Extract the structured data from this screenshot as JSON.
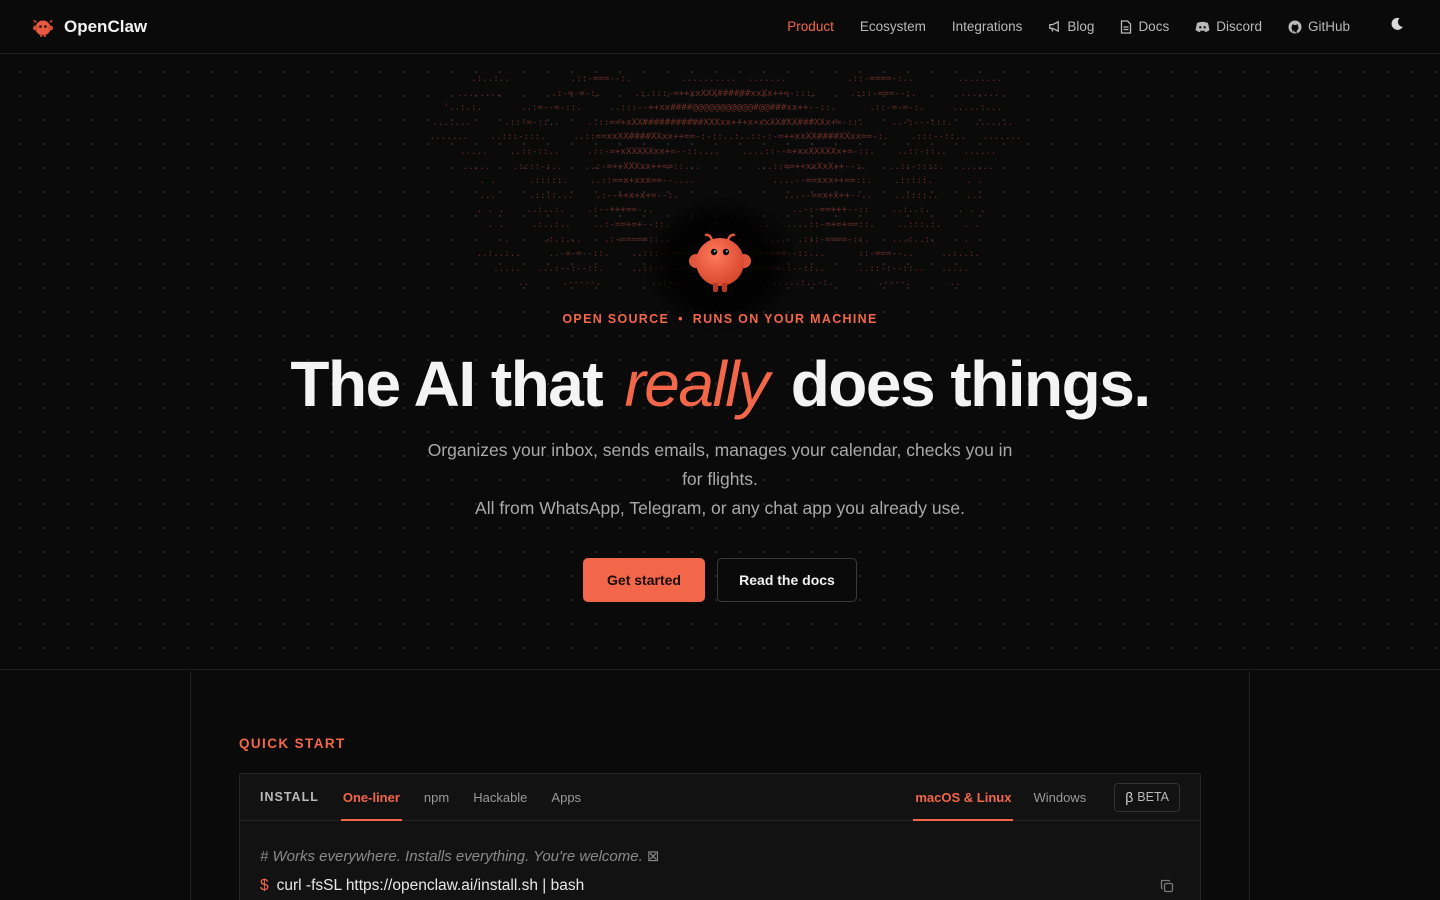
{
  "nav": {
    "brand": "OpenClaw",
    "links": [
      {
        "label": "Product",
        "active": true
      },
      {
        "label": "Ecosystem"
      },
      {
        "label": "Integrations"
      },
      {
        "label": "Blog",
        "icon": "megaphone-icon"
      },
      {
        "label": "Docs",
        "icon": "document-icon"
      },
      {
        "label": "Discord",
        "icon": "discord-icon"
      },
      {
        "label": "GitHub",
        "icon": "github-icon"
      }
    ],
    "theme_toggle_icon": "moon-icon"
  },
  "hero": {
    "eyebrow_left": "OPEN SOURCE",
    "eyebrow_sep": "•",
    "eyebrow_right": "RUNS ON YOUR MACHINE",
    "headline_pre": "The AI that",
    "headline_em": "really",
    "headline_post": "does things.",
    "sub_line1": "Organizes your inbox, sends emails, manages your calendar, checks you in for flights.",
    "sub_line2": "All from WhatsApp, Telegram, or any chat app you already use.",
    "cta_primary": "Get started",
    "cta_secondary": "Read the docs"
  },
  "quick_start": {
    "title": "QUICK START",
    "install_label": "INSTALL",
    "method_tabs": [
      {
        "label": "One-liner",
        "active": true
      },
      {
        "label": "npm"
      },
      {
        "label": "Hackable"
      },
      {
        "label": "Apps"
      }
    ],
    "os_tabs": [
      {
        "label": "macOS & Linux",
        "active": true
      },
      {
        "label": "Windows"
      }
    ],
    "beta_label": "BETA",
    "beta_glyph": "β",
    "comment": "# Works everywhere. Installs everything. You're welcome. ⊠",
    "prompt": "$",
    "command": "curl -fsSL https://openclaw.ai/install.sh | bash",
    "copy_icon": "copy-icon"
  },
  "colors": {
    "accent": "#f2674a",
    "background": "#0a0a0a",
    "card": "#121212",
    "ascii": "#6e2f24"
  }
}
